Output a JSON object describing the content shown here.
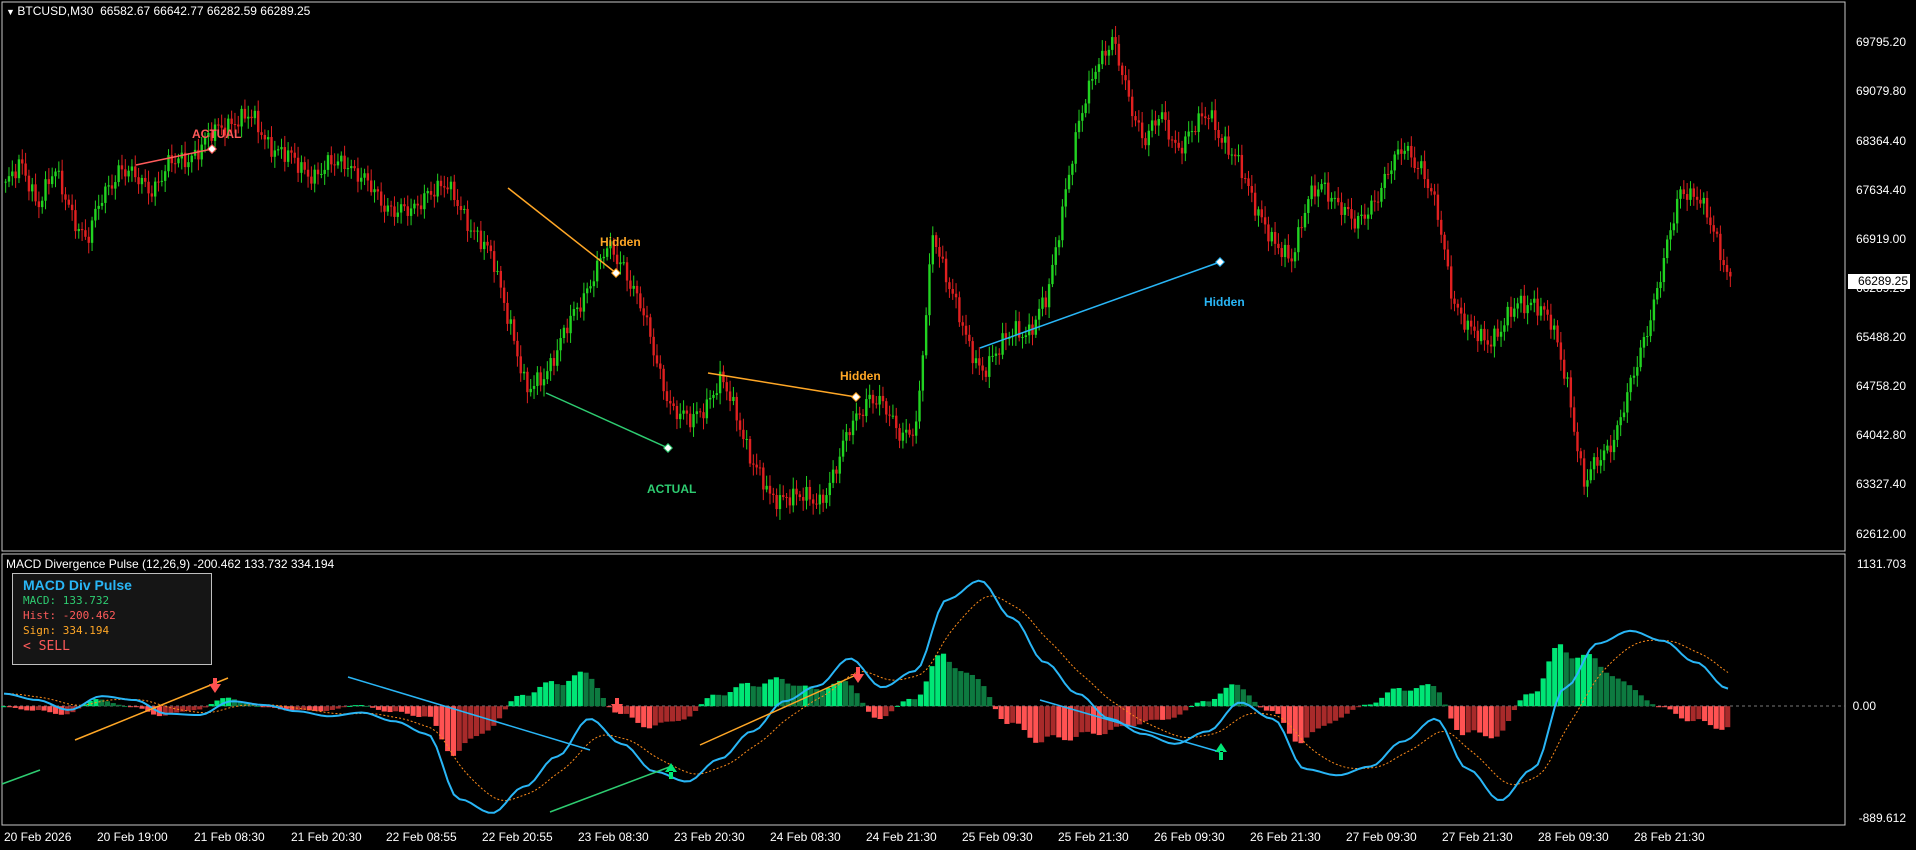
{
  "main_header": {
    "symbol": "BTCUSD,M30",
    "ohlc": "66582.67 66642.77 66282.59 66289.25"
  },
  "indicator_header": "MACD Divergence Pulse (12,26,9) -200.462 133.732 334.194",
  "price_axis": [
    "69795.20",
    "69079.80",
    "68364.40",
    "67634.40",
    "66919.00",
    "66289.25",
    "65488.20",
    "64758.20",
    "64042.80",
    "63327.40",
    "62612.00"
  ],
  "current_price": "66289.25",
  "indicator_axis": {
    "top": "1131.703",
    "zero": "0.00",
    "bottom": "-889.612"
  },
  "time_axis": [
    "20 Feb 2026",
    "20 Feb 19:00",
    "21 Feb 08:30",
    "21 Feb 20:30",
    "22 Feb 08:55",
    "22 Feb 20:55",
    "23 Feb 08:30",
    "23 Feb 20:30",
    "24 Feb 08:30",
    "24 Feb 21:30",
    "25 Feb 09:30",
    "25 Feb 21:30",
    "26 Feb 09:30",
    "26 Feb 21:30",
    "27 Feb 09:30",
    "27 Feb 21:30",
    "28 Feb 09:30",
    "28 Feb 21:30"
  ],
  "annotations": [
    {
      "text": "ACTUAL",
      "color": "#ff5b5b"
    },
    {
      "text": "Hidden",
      "color": "#ffa726"
    },
    {
      "text": "ACTUAL",
      "color": "#2ecc71"
    },
    {
      "text": "Hidden",
      "color": "#ffa726"
    },
    {
      "text": "Hidden",
      "color": "#29b6f6"
    }
  ],
  "info_panel": {
    "title": "MACD Div Pulse",
    "macd": "MACD: 133.732",
    "hist": "Hist: -200.462",
    "sign": "Sign: 334.194",
    "signal": "< SELL"
  },
  "colors": {
    "bull": "#21d321",
    "bear": "#e02020",
    "macd": "#29b6f6",
    "signal": "#ff8c1a",
    "hist_up": "#00e676",
    "hist_up_dark": "#0d7a40",
    "hist_down": "#ff5252",
    "hist_down_dark": "#a82a2a",
    "macd_text": "#2ecc71",
    "hist_text": "#ff5b5b",
    "sign_text": "#ffa726",
    "sell_text": "#ff5b5b"
  },
  "chart_data": {
    "type": "candlestick",
    "symbol": "BTCUSD",
    "timeframe": "M30",
    "close_path": [
      67634,
      67900,
      67400,
      67800,
      67300,
      66800,
      67500,
      67900,
      67700,
      67600,
      67900,
      68000,
      68200,
      68400,
      68600,
      68600,
      68300,
      68100,
      67900,
      67800,
      67900,
      68000,
      67700,
      67400,
      67300,
      67200,
      67600,
      67600,
      67300,
      66900,
      66500,
      65700,
      64600,
      64900,
      65300,
      65800,
      66300,
      66700,
      66500,
      65900,
      65100,
      64400,
      64200,
      64500,
      64800,
      64300,
      63600,
      63100,
      63200,
      63100,
      63100,
      63500,
      64200,
      64600,
      64400,
      64100,
      64100,
      67000,
      66200,
      65400,
      65000,
      65200,
      65600,
      65500,
      66000,
      67400,
      68500,
      69400,
      69700,
      68900,
      68300,
      68600,
      68200,
      68400,
      68700,
      68200,
      67800,
      67300,
      66700,
      66600,
      67400,
      67600,
      67400,
      67000,
      67400,
      67800,
      68200,
      67900,
      67200,
      66000,
      65500,
      65400,
      65600,
      65900,
      66000,
      65600,
      64800,
      63300,
      63700,
      64100,
      64800,
      65700,
      66600,
      67600,
      67500,
      66900,
      66300
    ],
    "divergences": [
      {
        "label": "ACTUAL",
        "type": "bearish regular"
      },
      {
        "label": "Hidden",
        "type": "bearish hidden"
      },
      {
        "label": "ACTUAL",
        "type": "bullish regular"
      },
      {
        "label": "Hidden",
        "type": "bearish hidden"
      },
      {
        "label": "Hidden",
        "type": "bullish hidden"
      }
    ],
    "indicator": {
      "name": "MACD Divergence Pulse",
      "params": [
        12,
        26,
        9
      ],
      "histogram": -200.462,
      "macd": 133.732,
      "signal": 334.194,
      "ylim": [
        -889.612,
        1131.703
      ],
      "macd_path": [
        100,
        50,
        -30,
        80,
        50,
        -60,
        -70,
        40,
        10,
        -40,
        -80,
        -50,
        -120,
        -220,
        -740,
        -850,
        -640,
        -400,
        -100,
        -300,
        -520,
        -600,
        -420,
        -200,
        40,
        160,
        380,
        150,
        280,
        850,
        1000,
        700,
        350,
        100,
        -100,
        -220,
        -300,
        -200,
        30,
        -100,
        -500,
        -550,
        -480,
        -280,
        -100,
        -500,
        -750,
        -500,
        150,
        500,
        600,
        520,
        350,
        140
      ]
    }
  }
}
